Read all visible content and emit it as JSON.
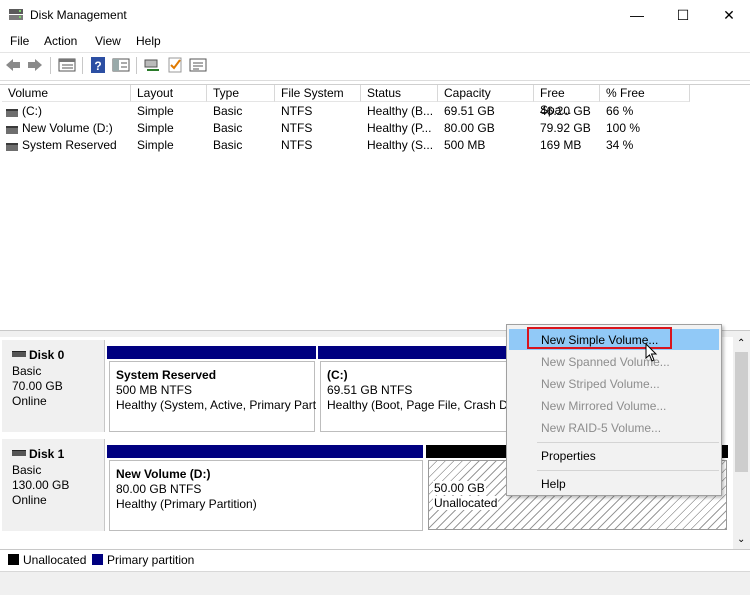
{
  "window": {
    "title": "Disk Management",
    "minimize_glyph": "—",
    "maximize_glyph": "☐",
    "close_glyph": "✕"
  },
  "menubar": {
    "items": [
      "File",
      "Action",
      "View",
      "Help"
    ]
  },
  "toolbar": {
    "icons": [
      "back-icon",
      "forward-icon",
      "list-view-icon",
      "help-icon",
      "split-view-icon",
      "connect-icon",
      "checklist-icon",
      "properties-icon"
    ]
  },
  "volume_table": {
    "columns": [
      "Volume",
      "Layout",
      "Type",
      "File System",
      "Status",
      "Capacity",
      "Free Spa...",
      "% Free"
    ],
    "rows": [
      [
        "(C:)",
        "Simple",
        "Basic",
        "NTFS",
        "Healthy (B...",
        "69.51 GB",
        "46.20 GB",
        "66 %"
      ],
      [
        "New Volume (D:)",
        "Simple",
        "Basic",
        "NTFS",
        "Healthy (P...",
        "80.00 GB",
        "79.92 GB",
        "100 %"
      ],
      [
        "System Reserved",
        "Simple",
        "Basic",
        "NTFS",
        "Healthy (S...",
        "500 MB",
        "169 MB",
        "34 %"
      ]
    ]
  },
  "disks": [
    {
      "name": "Disk 0",
      "type": "Basic",
      "size": "70.00 GB",
      "status": "Online",
      "partitions": [
        {
          "name": "System Reserved",
          "size": "500 MB NTFS",
          "health": "Healthy (System, Active, Primary Part"
        },
        {
          "name": "(C:)",
          "size": "69.51 GB NTFS",
          "health": "Healthy (Boot, Page File, Crash Du"
        }
      ]
    },
    {
      "name": "Disk 1",
      "type": "Basic",
      "size": "130.00 GB",
      "status": "Online",
      "partitions": [
        {
          "name": "New Volume  (D:)",
          "size": "80.00 GB NTFS",
          "health": "Healthy (Primary Partition)"
        },
        {
          "name": "",
          "size": "50.00 GB",
          "health": "Unallocated"
        }
      ]
    }
  ],
  "legend": {
    "unallocated": "Unallocated",
    "primary": "Primary partition"
  },
  "colors": {
    "primary": "#000080",
    "unallocated": "#000000",
    "highlight": "#91c9f7",
    "callout": "#d9141c"
  },
  "context_menu": {
    "items": [
      {
        "label": "New Simple Volume...",
        "enabled": true,
        "highlighted": true
      },
      {
        "label": "New Spanned Volume...",
        "enabled": false
      },
      {
        "label": "New Striped Volume...",
        "enabled": false
      },
      {
        "label": "New Mirrored Volume...",
        "enabled": false
      },
      {
        "label": "New RAID-5 Volume...",
        "enabled": false
      },
      {
        "label": "Properties",
        "enabled": true
      },
      {
        "label": "Help",
        "enabled": true
      }
    ]
  }
}
